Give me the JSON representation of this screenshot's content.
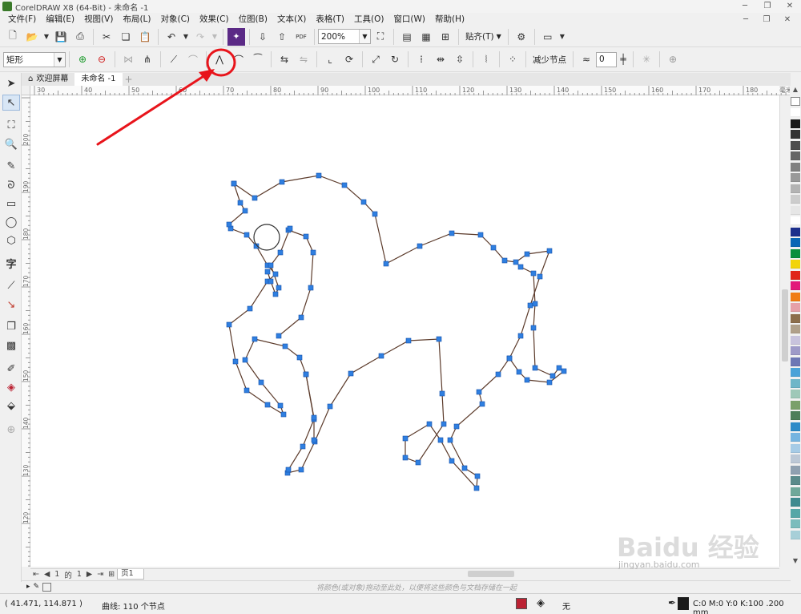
{
  "titlebar": {
    "title": "CorelDRAW X8 (64-Bit) - 未命名 -1"
  },
  "menu": [
    "文件(F)",
    "编辑(E)",
    "视图(V)",
    "布局(L)",
    "对象(C)",
    "效果(C)",
    "位图(B)",
    "文本(X)",
    "表格(T)",
    "工具(O)",
    "窗口(W)",
    "帮助(H)"
  ],
  "toolbar1": {
    "zoom": "200%",
    "snap": "贴齐(T)"
  },
  "toolbar2": {
    "shape_select": "矩形",
    "reduce_nodes": "减少节点",
    "curve_smoothness": "0"
  },
  "tabs": {
    "home": "欢迎屏幕",
    "document": "未命名 -1"
  },
  "ruler": {
    "h": [
      "30",
      "40",
      "50",
      "60",
      "70",
      "80",
      "90",
      "100",
      "110",
      "120",
      "130",
      "140",
      "150",
      "160",
      "170",
      "180"
    ],
    "v": [
      "200",
      "190",
      "180",
      "170",
      "160",
      "150",
      "140",
      "130",
      "120"
    ],
    "unit": "毫米"
  },
  "pagenav": {
    "current": "1",
    "of": "的",
    "total": "1",
    "page_tab": "页1"
  },
  "docpalette": {
    "hint": "将颜色(或对象)拖动至此处，以便将这些颜色与文档存储在一起"
  },
  "status": {
    "coords": "( 41.471, 114.871 )",
    "object": "曲线: 110 个节点",
    "fill": "无",
    "outline": "C:0 M:0 Y:0 K:100  .200 mm"
  },
  "watermark": {
    "text": "Baidu 经验",
    "url": "jingyan.baidu.com"
  },
  "colors": {
    "accent": "#1f6fd1",
    "annotation": "#e8141b",
    "curve": "#5b3a2a",
    "node": "#2f7fe0"
  },
  "palette": [
    "#ffffff",
    "#1a1a1a",
    "#333333",
    "#4d4d4d",
    "#666666",
    "#808080",
    "#999999",
    "#b3b3b3",
    "#cccccc",
    "#e6e6e6",
    "#ffffff",
    "#1c2f8c",
    "#0a66b5",
    "#0a8f3c",
    "#f2d40a",
    "#e0261b",
    "#e2197a",
    "#f07c16",
    "#e6a0a8",
    "#8c6e4b",
    "#b0a08a",
    "#c8c3dd",
    "#9e9ac8",
    "#6d77b5",
    "#4aa2d8",
    "#6fb6c8",
    "#9ec8b8",
    "#7aa06a",
    "#4e7e5a",
    "#2e8bc8",
    "#75b4e0",
    "#a6cbe6",
    "#bcc8d6",
    "#8fa0b0",
    "#5a8a8a",
    "#6fa89a",
    "#3f8a8f",
    "#56a7a7",
    "#7bbcbc",
    "#a7cfd8"
  ],
  "icons": [
    "new-doc-icon",
    "open-icon",
    "save-icon",
    "print-icon",
    "undo-icon",
    "redo-icon",
    "pdf-icon",
    "gear-icon",
    "node-tool-icon",
    "pick-tool-icon",
    "zoom-icon"
  ]
}
